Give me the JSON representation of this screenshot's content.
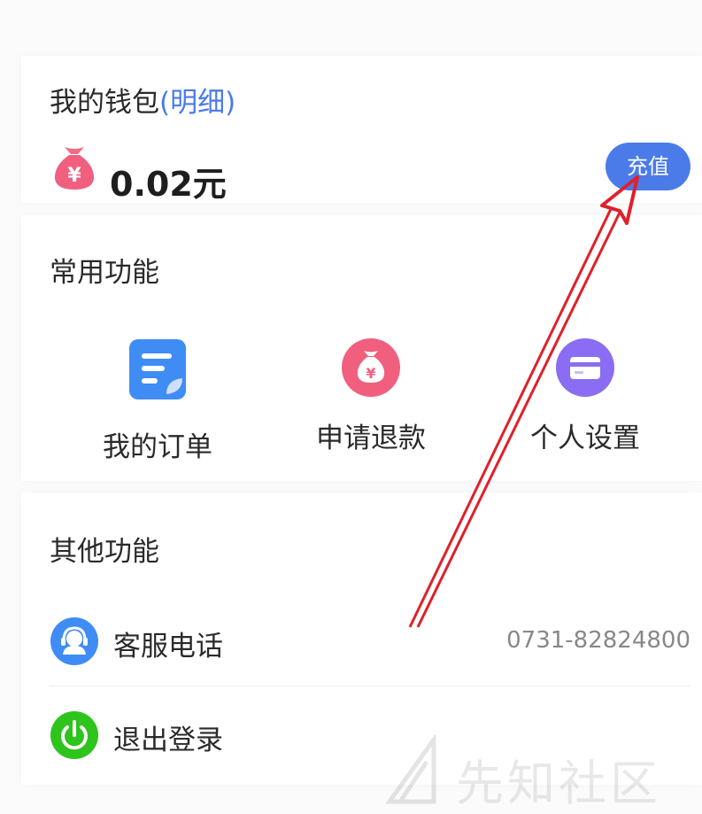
{
  "wallet": {
    "title": "我的钱包",
    "detail_link": "(明细)",
    "balance": "0.02元",
    "recharge_label": "充值"
  },
  "common_functions": {
    "title": "常用功能",
    "items": [
      {
        "label": "我的订单",
        "icon": "order-list-icon"
      },
      {
        "label": "申请退款",
        "icon": "money-bag-icon"
      },
      {
        "label": "个人设置",
        "icon": "card-icon"
      }
    ]
  },
  "other_functions": {
    "title": "其他功能",
    "items": [
      {
        "label": "客服电话",
        "value": "0731-82824800",
        "icon": "customer-service-icon"
      },
      {
        "label": "退出登录",
        "icon": "power-icon"
      }
    ]
  },
  "watermark": {
    "text": "先知社区"
  },
  "colors": {
    "accent": "#4a7be8",
    "refund_pink": "#f0607e",
    "settings_purple": "#8a6df2",
    "power_green": "#2ec41c",
    "service_blue": "#3f8cf5",
    "annotation_red": "#e0202a"
  }
}
